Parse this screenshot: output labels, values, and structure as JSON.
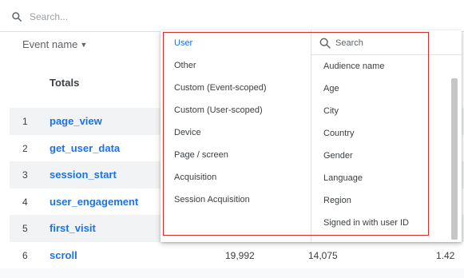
{
  "search": {
    "placeholder": "Search..."
  },
  "table": {
    "event_name_header": "Event name",
    "totals_label": "Totals",
    "rows": [
      {
        "index": "1",
        "name": "page_view"
      },
      {
        "index": "2",
        "name": "get_user_data"
      },
      {
        "index": "3",
        "name": "session_start"
      },
      {
        "index": "4",
        "name": "user_engagement"
      },
      {
        "index": "5",
        "name": "first_visit"
      },
      {
        "index": "6",
        "name": "scroll",
        "v1": "19,992",
        "v2": "14,075",
        "v3": "1.42"
      }
    ]
  },
  "dropdown": {
    "categories": [
      "User",
      "Other",
      "Custom (Event-scoped)",
      "Custom (User-scoped)",
      "Device",
      "Page / screen",
      "Acquisition",
      "Session Acquisition"
    ],
    "selected_category": "User",
    "search_placeholder": "Search",
    "dimensions": [
      "Audience name",
      "Age",
      "City",
      "Country",
      "Gender",
      "Language",
      "Region",
      "Signed in with user ID"
    ]
  },
  "colors": {
    "accent": "#1a73e8",
    "highlight": "#d32f2f",
    "row_shade": "#f1f3f4"
  }
}
